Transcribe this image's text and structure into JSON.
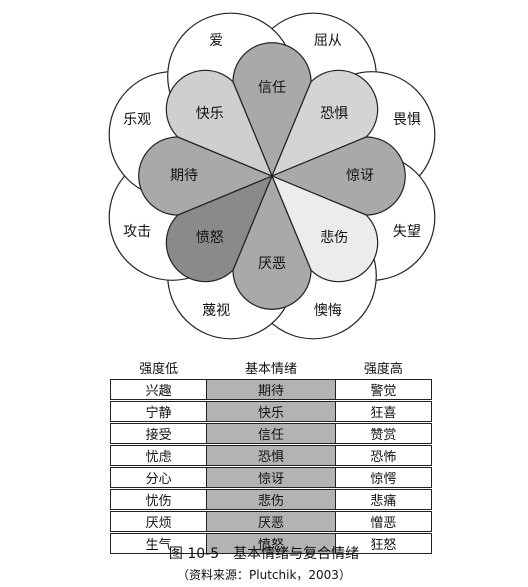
{
  "wheel": {
    "petals": [
      {
        "name": "信任",
        "fill": "#a9a9a9"
      },
      {
        "name": "恐惧",
        "fill": "#d4d4d4"
      },
      {
        "name": "惊讶",
        "fill": "#a9a9a9"
      },
      {
        "name": "悲伤",
        "fill": "#ececec"
      },
      {
        "name": "厌恶",
        "fill": "#a9a9a9"
      },
      {
        "name": "愤怒",
        "fill": "#8a8a8a"
      },
      {
        "name": "期待",
        "fill": "#a9a9a9"
      },
      {
        "name": "快乐",
        "fill": "#cfcfcf"
      }
    ],
    "outer_labels": [
      "屈从",
      "畏惧",
      "失望",
      "懊悔",
      "蔑视",
      "攻击",
      "乐观",
      "爱"
    ]
  },
  "table": {
    "headers": [
      "强度低",
      "基本情绪",
      "强度高"
    ],
    "rows": [
      [
        "兴趣",
        "期待",
        "警觉"
      ],
      [
        "宁静",
        "快乐",
        "狂喜"
      ],
      [
        "接受",
        "信任",
        "赞赏"
      ],
      [
        "忧虑",
        "恐惧",
        "恐怖"
      ],
      [
        "分心",
        "惊讶",
        "惊愕"
      ],
      [
        "忧伤",
        "悲伤",
        "悲痛"
      ],
      [
        "厌烦",
        "厌恶",
        "憎恶"
      ],
      [
        "生气",
        "愤怒",
        "狂怒"
      ]
    ]
  },
  "caption": "图 10-5　基本情绪与复合情绪",
  "source": "（资料来源：Plutchik，2003）"
}
